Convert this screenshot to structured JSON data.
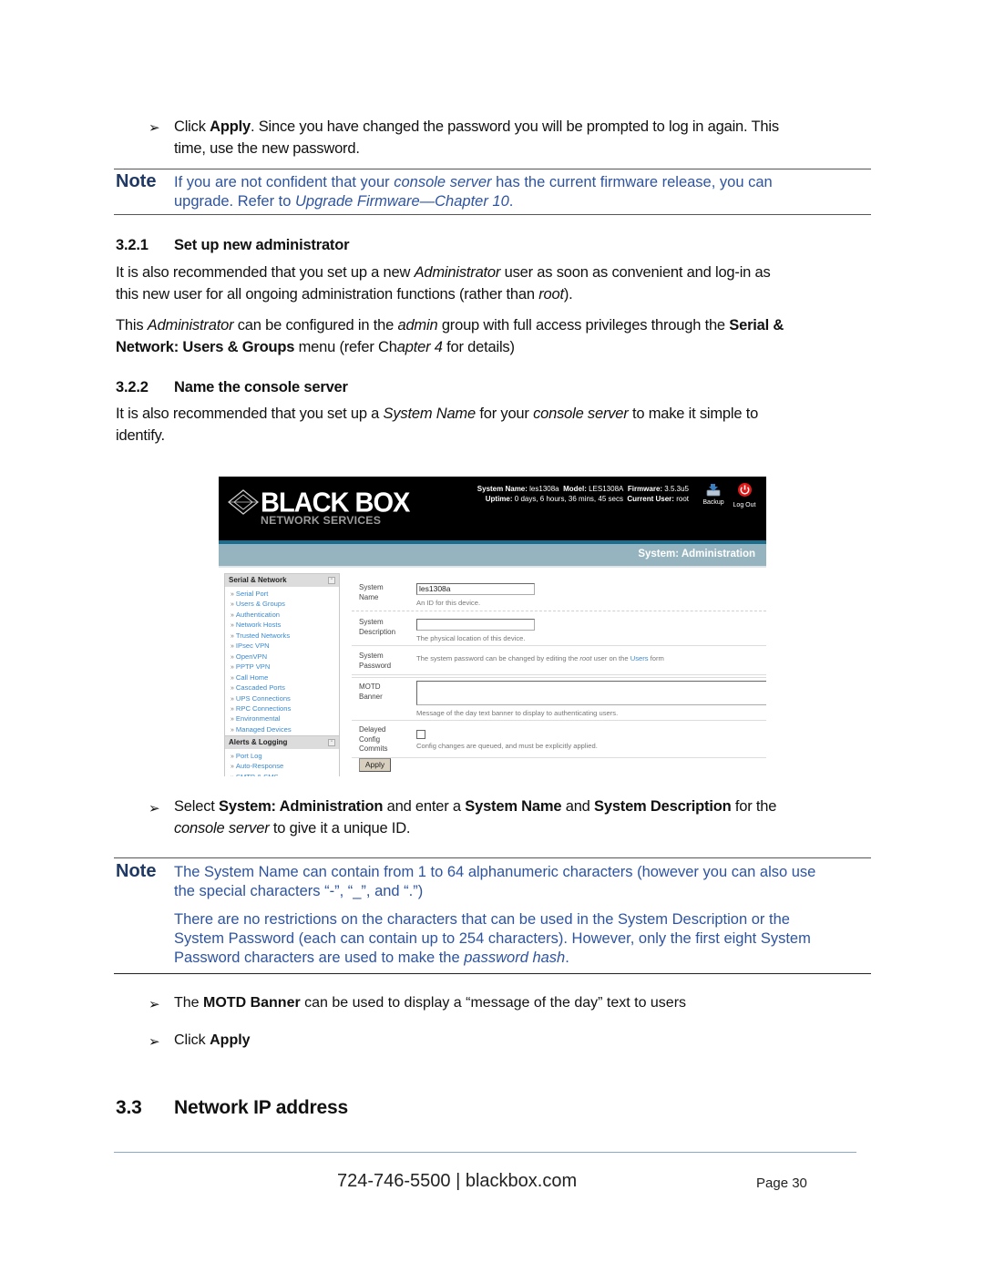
{
  "bullets_top": {
    "click_apply": {
      "pre": "Click ",
      "bold": "Apply",
      "post": ". Since you have changed the password you will be prompted to log in again. This",
      "line2": "time, use the new password."
    }
  },
  "note1": {
    "label": "Note",
    "line1_pre": "If you are not confident that your ",
    "line1_italic": "console server",
    "line1_post": " has the current firmware release, you can",
    "line2_pre": "upgrade. Refer to ",
    "line2_italic": "Upgrade Firmware—Chapter 10",
    "line2_post": "."
  },
  "section_3_2_1": {
    "number": "3.2.1",
    "title": "Set up new administrator",
    "para1": {
      "a": "It is also recommended that you set up a new ",
      "b_italic": "Administrator",
      "c": " user as soon as convenient and log-in as",
      "d": "this new user for all ongoing administration functions (rather than ",
      "e_italic": "root",
      "f": ")."
    },
    "para2": {
      "a": "This ",
      "b_italic": "Administrator",
      "c": " can be configured in the ",
      "d_italic": "admin",
      "e": " group with full access privileges through the ",
      "f_bold": "Serial &",
      "g_bold": "Network: Users & Groups",
      "h": " menu (refer Ch",
      "i_italic": "apter 4",
      "j": " for details)"
    }
  },
  "section_3_2_2": {
    "number": "3.2.2",
    "title": "Name the console server",
    "para1": {
      "a": "It is also recommended that you set up a ",
      "b_italic": "System Name",
      "c": " for your ",
      "d_italic": "console server",
      "e": " to make it simple to",
      "f": "identify."
    }
  },
  "screenshot": {
    "logo": {
      "brand": "BLACK BOX",
      "tagline": "NETWORK SERVICES"
    },
    "status": {
      "system_name_label": "System Name:",
      "system_name": "les1308a",
      "model_label": "Model:",
      "model": "LES1308A",
      "firmware_label": "Firmware:",
      "firmware": "3.5.3u5",
      "uptime_label": "Uptime:",
      "uptime": "0 days, 6 hours, 36 mins, 45 secs",
      "current_user_label": "Current User:",
      "current_user": "root"
    },
    "backup_label": "Backup",
    "logout_label": "Log Out",
    "page_title": "System: Administration",
    "sidebar": {
      "group1": {
        "title": "Serial & Network",
        "items": [
          "Serial Port",
          "Users & Groups",
          "Authentication",
          "Network Hosts",
          "Trusted Networks",
          "IPsec VPN",
          "OpenVPN",
          "PPTP VPN",
          "Call Home",
          "Cascaded Ports",
          "UPS Connections",
          "RPC Connections",
          "Environmental",
          "Managed Devices"
        ]
      },
      "group2": {
        "title": "Alerts & Logging",
        "items": [
          "Port Log",
          "Auto-Response",
          "SMTP & SMS"
        ]
      },
      "raquo": "»"
    },
    "form": {
      "system_name": {
        "label1": "System",
        "label2": "Name",
        "value": "les1308a",
        "help": "An ID for this device."
      },
      "system_description": {
        "label1": "System",
        "label2": "Description",
        "value": "",
        "help": "The physical location of this device."
      },
      "system_password": {
        "label1": "System",
        "label2": "Password",
        "help_a": "The system password can be changed by editing the ",
        "help_italic": "root",
        "help_b": " user on the ",
        "help_link": "Users",
        "help_c": " form"
      },
      "motd_banner": {
        "label1": "MOTD",
        "label2": "Banner",
        "value": "",
        "help": "Message of the day text banner to display to authenticating users."
      },
      "delayed_commits": {
        "label1": "Delayed",
        "label2": "Config",
        "label3": "Commits",
        "checked": false,
        "help": "Config changes are queued, and must be explicitly applied."
      },
      "apply_label": "Apply"
    }
  },
  "bullet_select": {
    "a": "Select ",
    "b_bold": "System: Administration",
    "c": " and enter a ",
    "d_bold": "System Name",
    "e": " and ",
    "f_bold": "System Description",
    "g": " for the",
    "h_italic": "console server",
    "i": " to give it a unique ID."
  },
  "note2": {
    "label": "Note",
    "line1": "The System Name can contain from 1 to 64 alphanumeric characters (however you can also use",
    "line2": "the special characters “-”, “_”, and “.”)",
    "para2_line1": "There are no restrictions on the characters that can be used in the System Description or the",
    "para2_line2": "System Password (each can contain up to 254 characters). However, only the first eight System",
    "para2_line3_pre": "Password characters are used to make the ",
    "para2_line3_italic": "password hash",
    "para2_line3_post": "."
  },
  "bullet_motd": {
    "a": "The ",
    "b_bold": "MOTD Banner",
    "c": " can be used to display a “message of the day” text to users"
  },
  "bullet_apply": {
    "a": "Click ",
    "b_bold": "Apply"
  },
  "section_3_3": {
    "number": "3.3",
    "title": "Network IP address"
  },
  "footer": {
    "contact": "724-746-5500 | blackbox.com",
    "page": "Page 30"
  },
  "icons": {
    "bullet": "➢"
  }
}
